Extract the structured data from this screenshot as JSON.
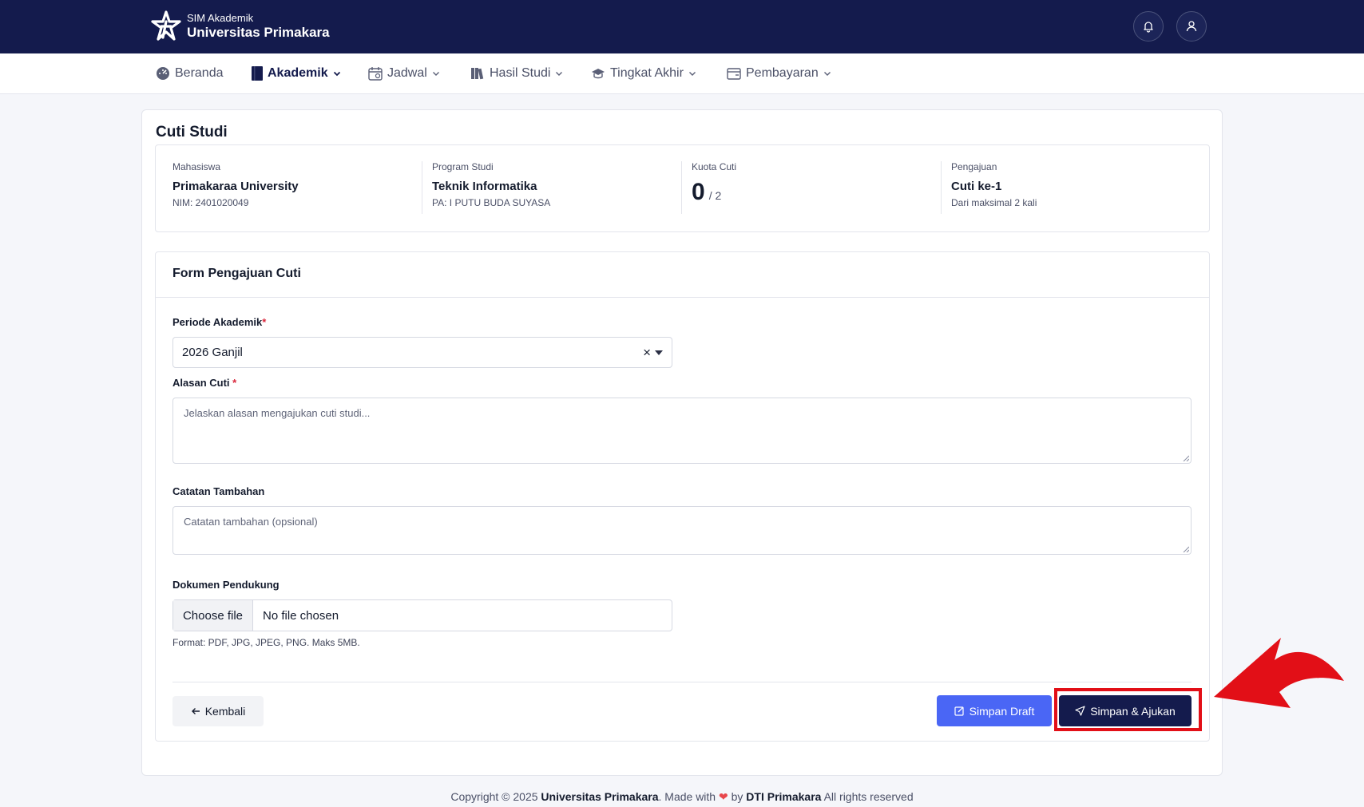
{
  "brand": {
    "subtitle": "SIM Akademik",
    "title": "Universitas Primakara"
  },
  "nav": {
    "items": [
      {
        "label": "Beranda",
        "icon": "dashboard-icon"
      },
      {
        "label": "Akademik",
        "icon": "book-icon"
      },
      {
        "label": "Jadwal",
        "icon": "calendar-icon"
      },
      {
        "label": "Hasil Studi",
        "icon": "books-icon"
      },
      {
        "label": "Tingkat Akhir",
        "icon": "graduation-cap-icon"
      },
      {
        "label": "Pembayaran",
        "icon": "wallet-icon"
      }
    ]
  },
  "page": {
    "title": "Cuti Studi"
  },
  "info": {
    "student": {
      "label": "Mahasiswa",
      "value": "Primakaraa University",
      "sub": "NIM: 2401020049"
    },
    "program": {
      "label": "Program Studi",
      "value": "Teknik Informatika",
      "sub": "PA: I PUTU BUDA SUYASA"
    },
    "quota": {
      "label": "Kuota Cuti",
      "used": "0",
      "max": "/ 2"
    },
    "submission": {
      "label": "Pengajuan",
      "value": "Cuti ke-1",
      "sub": "Dari maksimal 2 kali"
    }
  },
  "form": {
    "title": "Form Pengajuan Cuti",
    "period": {
      "label": "Periode Akademik",
      "required": "*",
      "value": "2026 Ganjil",
      "clear": "×"
    },
    "reason": {
      "label": "Alasan Cuti",
      "required": "*",
      "placeholder": "Jelaskan alasan mengajukan cuti studi..."
    },
    "notes": {
      "label": "Catatan Tambahan",
      "placeholder": "Catatan tambahan (opsional)"
    },
    "document": {
      "label": "Dokumen Pendukung",
      "button": "Choose file",
      "status": "No file chosen",
      "hint": "Format: PDF, JPG, JPEG, PNG. Maks 5MB."
    },
    "buttons": {
      "back": "Kembali",
      "draft": "Simpan Draft",
      "submit": "Simpan & Ajukan"
    }
  },
  "footer": {
    "prefix": "Copyright © 2025 ",
    "org": "Universitas Primakara",
    "made": ". Made with ",
    "by": " by ",
    "team": "DTI Primakara",
    "suffix": " All rights reserved"
  },
  "colors": {
    "navy": "#141b4d",
    "draft_blue": "#4a66f5",
    "annotation_red": "#e20f17",
    "heart": "#e8474c"
  }
}
